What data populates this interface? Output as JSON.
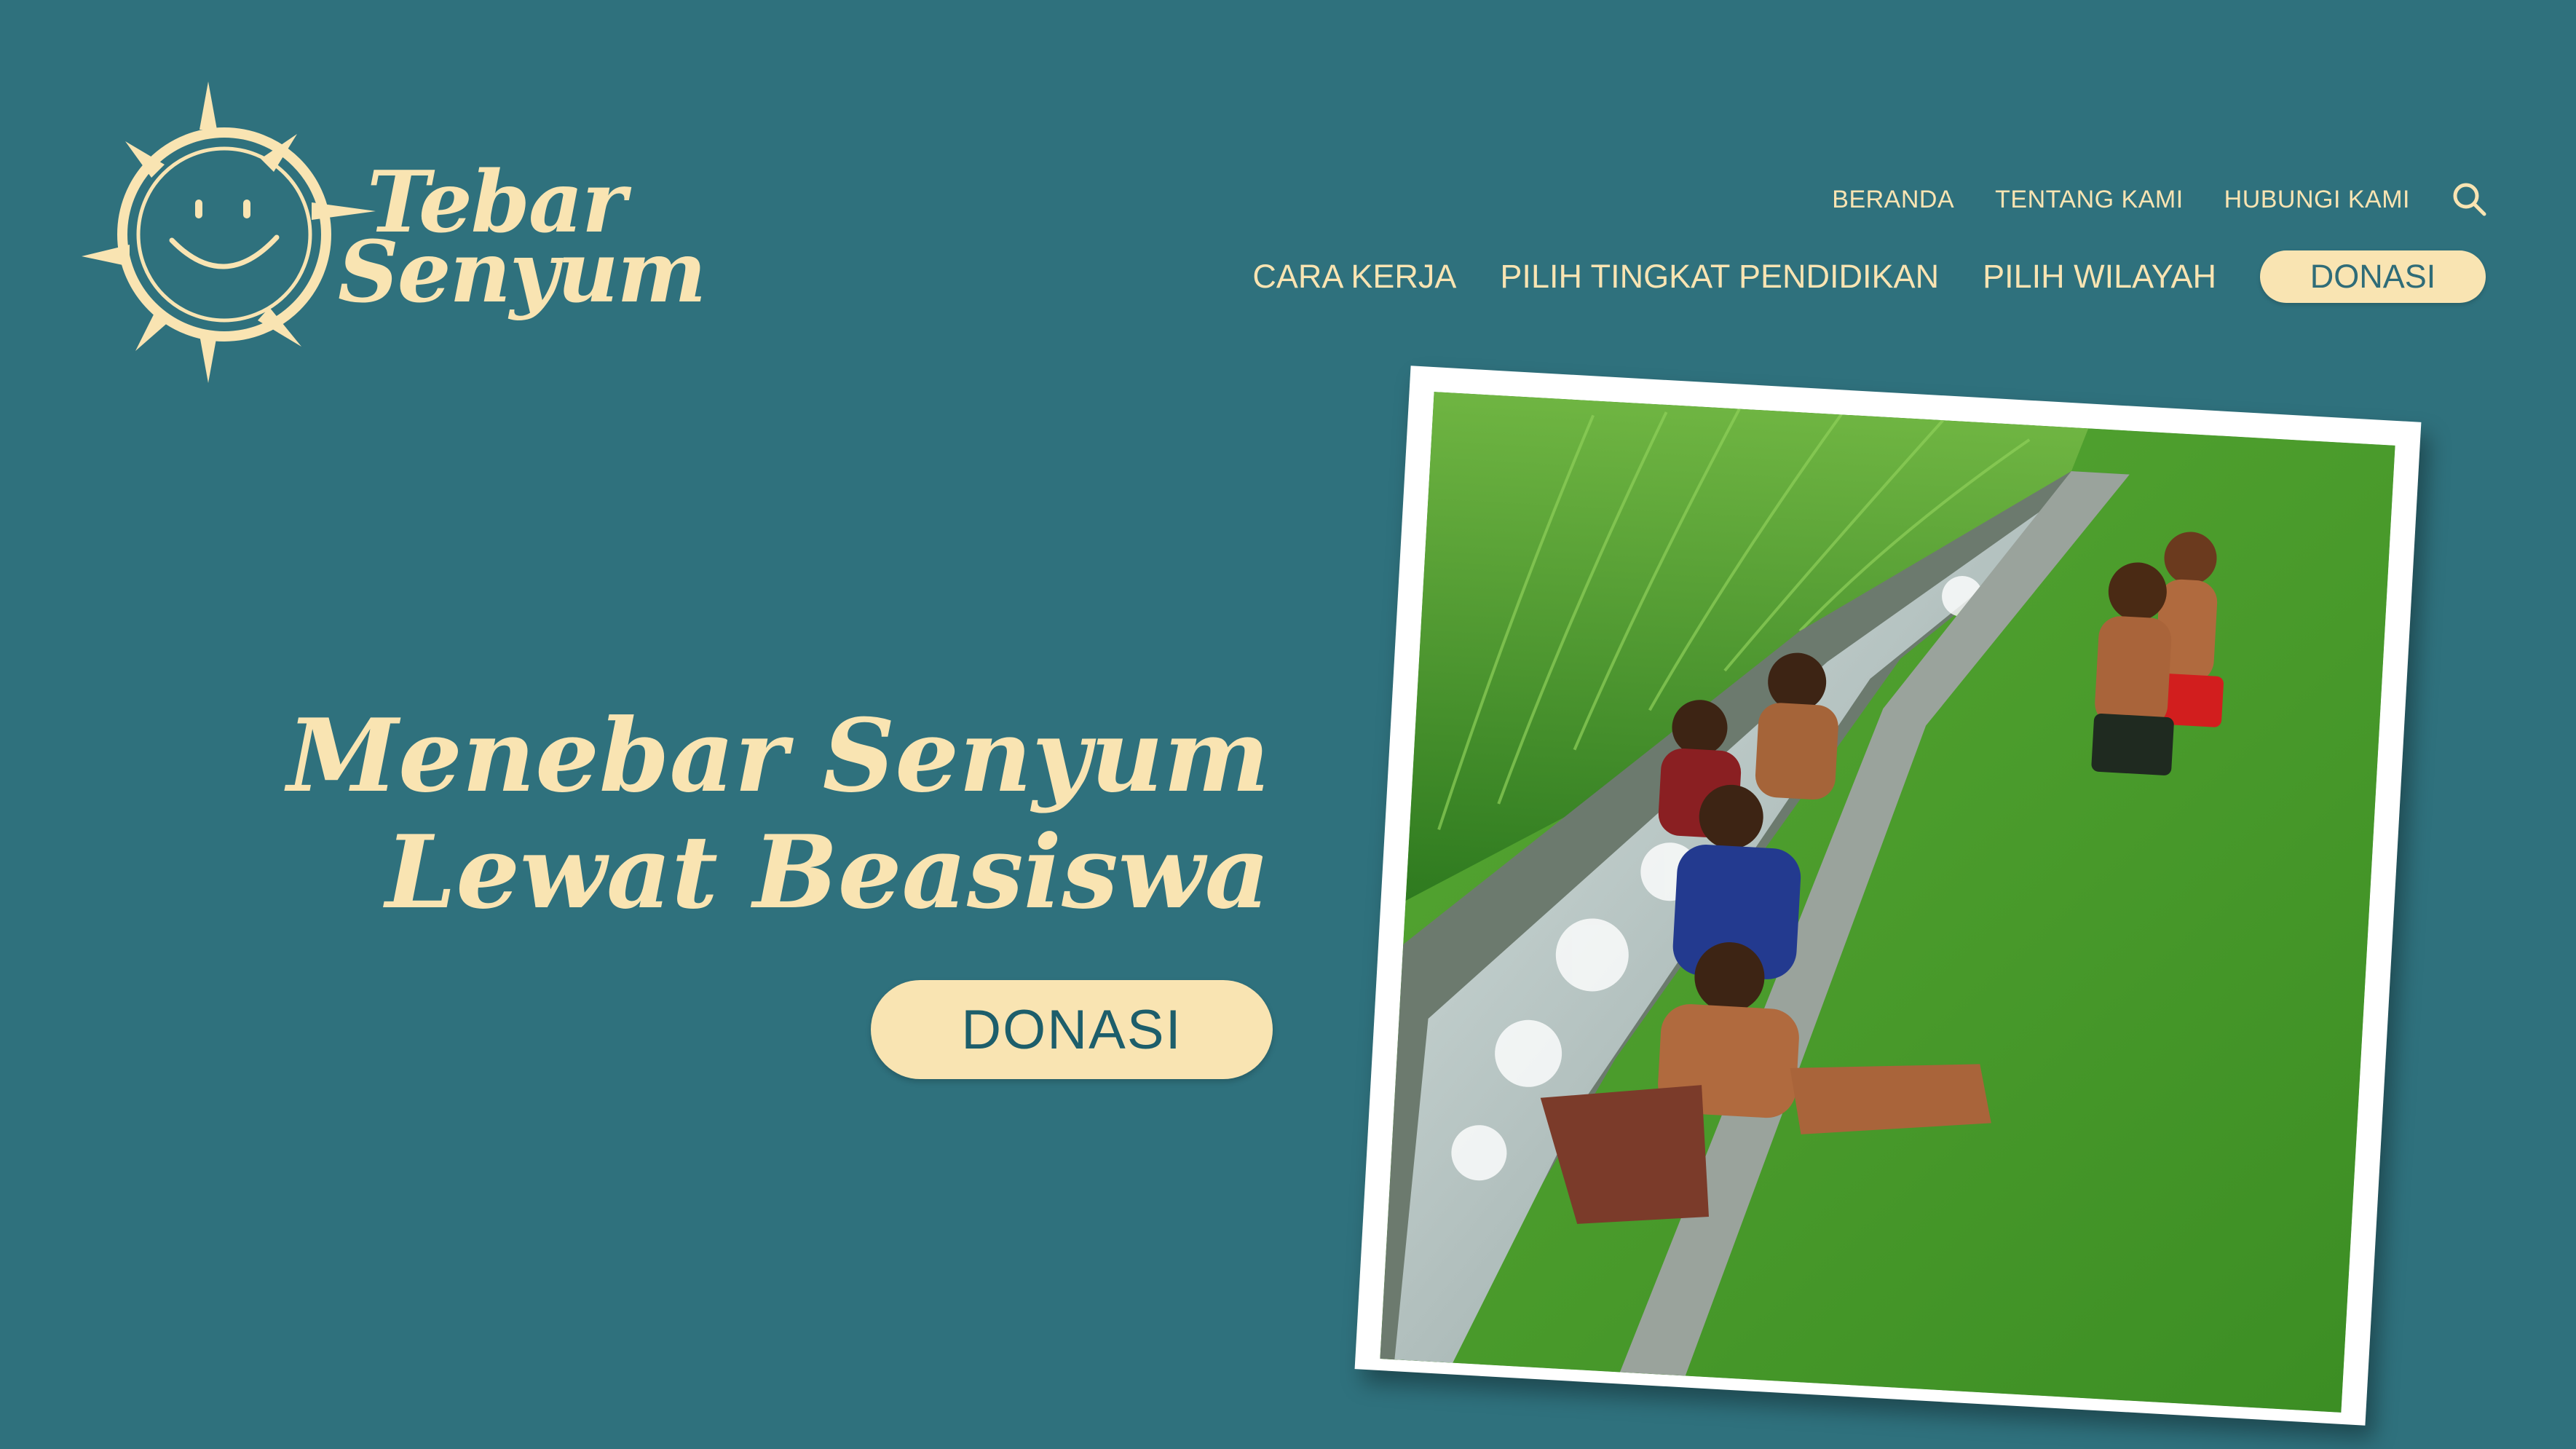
{
  "brand": {
    "logo_line1": "Tebar",
    "logo_line2": "Senyum"
  },
  "nav_top": {
    "items": [
      "BERANDA",
      "TENTANG KAMI",
      "HUBUNGI KAMI"
    ],
    "search_icon": "search-icon"
  },
  "nav_main": {
    "items": [
      "CARA KERJA",
      "PILIH TINGKAT PENDIDIKAN",
      "PILIH WILAYAH"
    ],
    "donate_label": "DONASI"
  },
  "hero": {
    "title_line1": "Menebar Senyum",
    "title_line2": "Lewat Beasiswa",
    "donate_label": "DONASI"
  },
  "colors": {
    "background": "#2f717d",
    "accent": "#f9e4b2",
    "button_text": "#2f6c78"
  }
}
